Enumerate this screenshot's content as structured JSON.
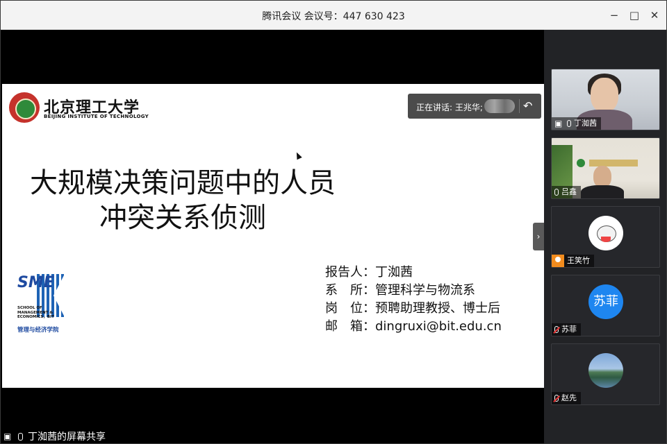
{
  "window": {
    "title": "腾讯会议 会议号：447 630 423",
    "minimize": "−",
    "maximize": "□",
    "close": "✕"
  },
  "slide": {
    "university_cn": "北京理工大学",
    "university_en": "BEIJING INSTITUTE OF TECHNOLOGY",
    "title_line1": "大规模决策问题中的人员",
    "title_line2": "冲突关系侦测",
    "info": [
      {
        "label": "报告人：",
        "value": "丁洳茜"
      },
      {
        "label": "系　所：",
        "value": "管理科学与物流系"
      },
      {
        "label": "岗　位：",
        "value": "预聘助理教授、博士后"
      },
      {
        "label": "邮　箱：",
        "value": "dingruxi@bit.edu.cn"
      }
    ],
    "school_logo": {
      "letters": "SME",
      "sub": "SCHOOL OF MANAGEMENT & ECONOMICS，BIT",
      "cn": "管理与经济学院"
    }
  },
  "speaking": {
    "label": "正在讲话: 王兆华;"
  },
  "share_footer": {
    "text": "丁洳茜的屏幕共享"
  },
  "participants": [
    {
      "name": "丁洳茜",
      "type": "video",
      "muted": false
    },
    {
      "name": "吕鑫",
      "type": "video",
      "muted": false
    },
    {
      "name": "王笑竹",
      "type": "avatar",
      "muted": false
    },
    {
      "name": "苏菲",
      "type": "text-avatar",
      "avatar_text": "苏菲",
      "muted": true
    },
    {
      "name": "赵先",
      "type": "avatar",
      "muted": true
    }
  ],
  "colors": {
    "accent": "#1e86f0",
    "panel_bg": "#222326",
    "titlebar_bg": "#f3f3f3"
  }
}
